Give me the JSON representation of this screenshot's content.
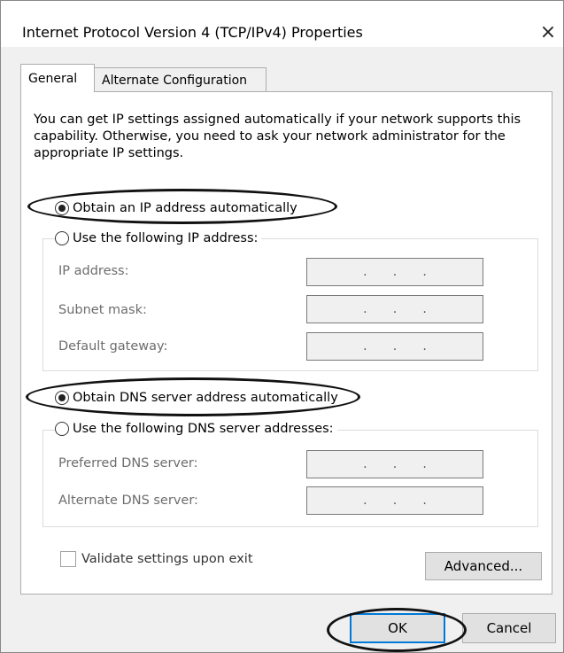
{
  "window": {
    "title": "Internet Protocol Version 4 (TCP/IPv4) Properties",
    "close_glyph": "×"
  },
  "tabs": [
    {
      "label": "General",
      "active": true
    },
    {
      "label": "Alternate Configuration",
      "active": false
    }
  ],
  "intro_text": "You can get IP settings assigned automatically if your network supports this capability. Otherwise, you need to ask your network administrator for the appropriate IP settings.",
  "ip_section": {
    "auto_label": "Obtain an IP address automatically",
    "auto_selected": true,
    "manual_label": "Use the following IP address:",
    "manual_selected": false,
    "fields": [
      {
        "label": "IP address:",
        "value": ". . ."
      },
      {
        "label": "Subnet mask:",
        "value": ". . ."
      },
      {
        "label": "Default gateway:",
        "value": ". . ."
      }
    ]
  },
  "dns_section": {
    "auto_label": "Obtain DNS server address automatically",
    "auto_selected": true,
    "manual_label": "Use the following DNS server addresses:",
    "manual_selected": false,
    "fields": [
      {
        "label": "Preferred DNS server:",
        "value": ". . ."
      },
      {
        "label": "Alternate DNS server:",
        "value": ". . ."
      }
    ]
  },
  "validate": {
    "label": "Validate settings upon exit",
    "checked": false
  },
  "buttons": {
    "advanced": "Advanced...",
    "ok": "OK",
    "cancel": "Cancel"
  },
  "colors": {
    "accent": "#0078d7",
    "annotation": "#111111"
  }
}
